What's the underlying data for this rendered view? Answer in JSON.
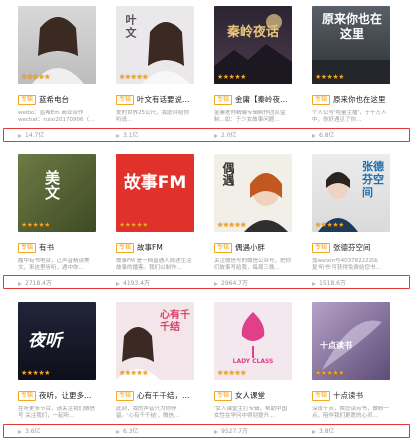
{
  "rows": [
    {
      "cards": [
        {
          "tag": "专辑",
          "title": "蓝希电台",
          "desc": "weibo：蓝希Em 商业合作 wechat：ruixi20170906（...",
          "plays": "14.7亿",
          "cover_text": "",
          "cover_bg": "#cfcfcf"
        },
        {
          "tag": "专辑",
          "title": "叶文有话要说20...",
          "desc": "爱的世界25公尺，我愿许给你 听说...",
          "plays": "3.1亿",
          "cover_text": "叶文",
          "cover_bg": "#e9e6ea"
        },
        {
          "tag": "专辑",
          "title": "金庸【秦岭夜话】",
          "desc": "金庸老师精编专辑制作团队监制...如：于少女故事问题...",
          "plays": "2.0亿",
          "cover_text": "秦岭夜话",
          "cover_bg": "#2b2431"
        },
        {
          "tag": "专辑",
          "title": "原来你也在这里",
          "desc": "个人公号'啦量主播'，于千万人中，你好遇见了你...",
          "plays": "6.8亿",
          "cover_text": "原来你也在这里",
          "cover_bg": "#3d4249"
        }
      ]
    },
    {
      "cards": [
        {
          "tag": "专辑",
          "title": "有书",
          "desc": "履中有书电台，让声音精读美文，来这里听听，遇中你...",
          "plays": "2718.4万",
          "cover_text": "美文",
          "cover_bg": "#5c6a3a"
        },
        {
          "tag": "专辑",
          "title": "故事FM",
          "desc": "故事FM 是一档普通人自述生活故事的播客。我们以制作...",
          "plays": "4193.4万",
          "cover_text": "故事FM",
          "cover_bg": "#e0322b"
        },
        {
          "tag": "专辑",
          "title": "偶遇小胖",
          "desc": "关注微信号的微信公众号，把你们故事写给我，每周三晚...",
          "plays": "2964.7万",
          "cover_text": "偶遇",
          "cover_bg": "#f2efe9"
        },
        {
          "tag": "专辑",
          "title": "张德芬空间",
          "desc": "加weixin号403782222回复'听书'可获得免费给您书...",
          "plays": "1518.6万",
          "cover_text": "张德芬空间",
          "cover_bg": "#1d3a5a"
        }
      ]
    },
    {
      "cards": [
        {
          "tag": "专辑",
          "title": "夜听，让更多的...",
          "desc": "在听更多节目，请关注我们微信号 关注我们，一起听...",
          "plays": "3.6亿",
          "cover_text": "夜听",
          "cover_bg": "#1b1d2c"
        },
        {
          "tag": "专辑",
          "title": "心有千千结，你...",
          "desc": "此刻，我的声音只为你停留。'心有千千结'，微信...",
          "plays": "6.3亿",
          "cover_text": "心有千千结",
          "cover_bg": "#f0e3e6"
        },
        {
          "tag": "专辑",
          "title": "女人课堂",
          "desc": "'女人课堂主打专辑，帮助中国女性在学问中得到提升...",
          "plays": "9527.7万",
          "cover_text": "LADY CLASS",
          "cover_bg": "#f4e8ef"
        },
        {
          "tag": "专辑",
          "title": "十点读书",
          "desc": "深夜十点，换您读点书，做粉一点，陪伴我们更愿的心灵...",
          "plays": "3.8亿",
          "cover_text": "十点读书",
          "cover_bg": "#7b6a8f"
        }
      ]
    }
  ]
}
